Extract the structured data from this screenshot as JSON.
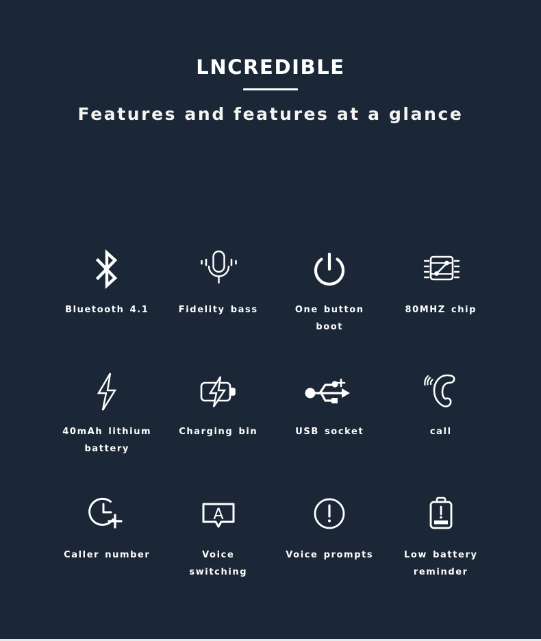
{
  "header": {
    "title": "LNCREDIBLE",
    "subtitle": "Features and features at a glance"
  },
  "colors": {
    "background": "#1b2736",
    "text": "#ffffff",
    "divider": "#ffffff",
    "bottom_strip": "#e9eaea"
  },
  "features": [
    {
      "icon": "bluetooth-icon",
      "label": "Bluetooth 4.1"
    },
    {
      "icon": "microphone-icon",
      "label": "Fidelity bass"
    },
    {
      "icon": "power-button-icon",
      "label": "One button boot"
    },
    {
      "icon": "chip-icon",
      "label": "80MHZ chip"
    },
    {
      "icon": "lightning-bolt-icon",
      "label": "40mAh lithium battery"
    },
    {
      "icon": "battery-charging-icon",
      "label": "Charging bin"
    },
    {
      "icon": "usb-icon",
      "label": "USB socket"
    },
    {
      "icon": "phone-handset-icon",
      "label": "call"
    },
    {
      "icon": "clock-plus-icon",
      "label": "Caller number"
    },
    {
      "icon": "speech-bubble-a-icon",
      "label": "Voice switching"
    },
    {
      "icon": "exclamation-circle-icon",
      "label": "Voice prompts"
    },
    {
      "icon": "low-battery-icon",
      "label": "Low battery reminder"
    }
  ]
}
